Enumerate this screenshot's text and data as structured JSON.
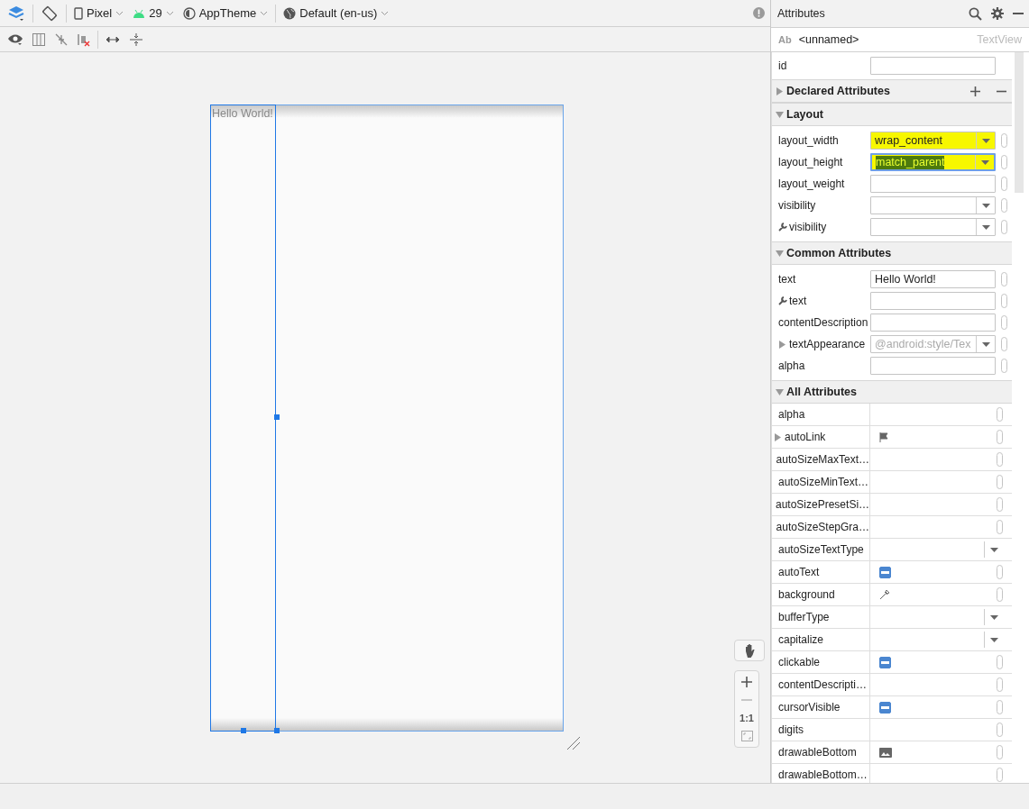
{
  "toolbar": {
    "items": [
      {
        "kind": "layers"
      },
      {
        "kind": "rotate"
      },
      {
        "kind": "device",
        "label": "Pixel"
      },
      {
        "kind": "api",
        "label": "29"
      },
      {
        "kind": "theme",
        "label": "AppTheme"
      },
      {
        "kind": "locale",
        "label": "Default (en-us)"
      }
    ]
  },
  "canvas": {
    "text_view": {
      "text": "Hello World!",
      "selected": true
    },
    "zoom": {
      "reset_label": "1:1"
    }
  },
  "attributes": {
    "title": "Attributes",
    "component": {
      "badge": "Ab",
      "name": "<unnamed>",
      "type": "TextView"
    },
    "id_row": {
      "label": "id"
    },
    "sections": [
      {
        "title": "Declared Attributes",
        "expanded": false,
        "kind": "declared"
      },
      {
        "title": "Layout",
        "expanded": true,
        "kind": "form",
        "rows": [
          {
            "label": "layout_width",
            "kind": "dropdown",
            "value": "wrap_content",
            "highlighted": true,
            "focused": false,
            "tool": false
          },
          {
            "label": "layout_height",
            "kind": "dropdown",
            "value": "match_parent",
            "highlighted": true,
            "focused": true,
            "tool": false
          },
          {
            "label": "layout_weight",
            "kind": "text",
            "highlighted": false,
            "focused": false,
            "tool": false
          },
          {
            "label": "visibility",
            "kind": "dropdown",
            "highlighted": false,
            "focused": false,
            "tool": false
          },
          {
            "label": "visibility",
            "kind": "dropdown",
            "highlighted": false,
            "focused": false,
            "tool": true
          }
        ]
      },
      {
        "title": "Common Attributes",
        "expanded": true,
        "kind": "form",
        "rows": [
          {
            "label": "text",
            "kind": "text",
            "value": "Hello World!",
            "highlighted": false,
            "focused": false,
            "tool": false
          },
          {
            "label": "text",
            "kind": "text",
            "highlighted": false,
            "focused": false,
            "tool": true
          },
          {
            "label": "contentDescription",
            "kind": "text",
            "highlighted": false,
            "focused": false,
            "tool": false
          },
          {
            "label": "textAppearance",
            "kind": "dropdown",
            "placeholder": "@android:style/Tex",
            "highlighted": false,
            "focused": false,
            "tool": false,
            "expandable": true
          },
          {
            "label": "alpha",
            "kind": "text",
            "highlighted": false,
            "focused": false,
            "tool": false
          }
        ]
      },
      {
        "title": "All Attributes",
        "expanded": true,
        "kind": "table",
        "rows": [
          {
            "label": "alpha",
            "kind": "text"
          },
          {
            "label": "autoLink",
            "kind": "flag",
            "expandable": true
          },
          {
            "label": "autoSizeMaxText…",
            "kind": "text"
          },
          {
            "label": "autoSizeMinText…",
            "kind": "text"
          },
          {
            "label": "autoSizePresetSi…",
            "kind": "text"
          },
          {
            "label": "autoSizeStepGra…",
            "kind": "text"
          },
          {
            "label": "autoSizeTextType",
            "kind": "dropdown"
          },
          {
            "label": "autoText",
            "kind": "boolean",
            "indeterminate": true
          },
          {
            "label": "background",
            "kind": "color"
          },
          {
            "label": "bufferType",
            "kind": "dropdown"
          },
          {
            "label": "capitalize",
            "kind": "dropdown"
          },
          {
            "label": "clickable",
            "kind": "boolean",
            "indeterminate": true
          },
          {
            "label": "contentDescripti…",
            "kind": "text"
          },
          {
            "label": "cursorVisible",
            "kind": "boolean",
            "indeterminate": true
          },
          {
            "label": "digits",
            "kind": "text"
          },
          {
            "label": "drawableBottom",
            "kind": "image"
          },
          {
            "label": "drawableBottom…",
            "kind": "text"
          }
        ]
      }
    ]
  }
}
